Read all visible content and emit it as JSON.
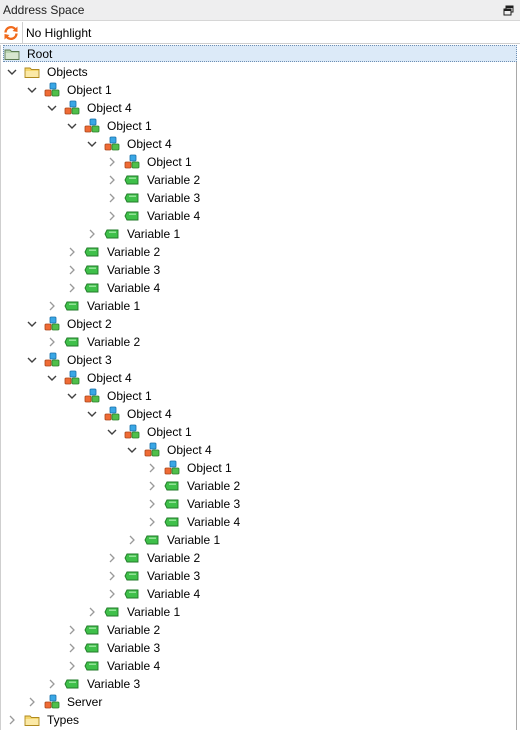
{
  "window": {
    "title": "Address Space"
  },
  "toolbar": {
    "highlight_label": "No Highlight"
  },
  "colors": {
    "selection": "#dceaf8",
    "variable_green": "#3fc04a",
    "folder_yellow": "#f5d76e"
  },
  "tree": [
    {
      "label": "Root",
      "depth": 0,
      "type": "root",
      "expand": "none",
      "selected": true
    },
    {
      "label": "Objects",
      "depth": 0,
      "type": "folder",
      "expand": "open"
    },
    {
      "label": "Object 1",
      "depth": 1,
      "type": "object",
      "expand": "open"
    },
    {
      "label": "Object 4",
      "depth": 2,
      "type": "object",
      "expand": "open"
    },
    {
      "label": "Object 1",
      "depth": 3,
      "type": "object",
      "expand": "open"
    },
    {
      "label": "Object 4",
      "depth": 4,
      "type": "object",
      "expand": "open"
    },
    {
      "label": "Object 1",
      "depth": 5,
      "type": "object",
      "expand": "closed"
    },
    {
      "label": "Variable 2",
      "depth": 5,
      "type": "variable",
      "expand": "closed"
    },
    {
      "label": "Variable 3",
      "depth": 5,
      "type": "variable",
      "expand": "closed"
    },
    {
      "label": "Variable 4",
      "depth": 5,
      "type": "variable",
      "expand": "closed"
    },
    {
      "label": "Variable 1",
      "depth": 4,
      "type": "variable",
      "expand": "closed"
    },
    {
      "label": "Variable 2",
      "depth": 3,
      "type": "variable",
      "expand": "closed"
    },
    {
      "label": "Variable 3",
      "depth": 3,
      "type": "variable",
      "expand": "closed"
    },
    {
      "label": "Variable 4",
      "depth": 3,
      "type": "variable",
      "expand": "closed"
    },
    {
      "label": "Variable 1",
      "depth": 2,
      "type": "variable",
      "expand": "closed"
    },
    {
      "label": "Object 2",
      "depth": 1,
      "type": "object",
      "expand": "open"
    },
    {
      "label": "Variable 2",
      "depth": 2,
      "type": "variable",
      "expand": "closed"
    },
    {
      "label": "Object 3",
      "depth": 1,
      "type": "object",
      "expand": "open"
    },
    {
      "label": "Object 4",
      "depth": 2,
      "type": "object",
      "expand": "open"
    },
    {
      "label": "Object 1",
      "depth": 3,
      "type": "object",
      "expand": "open"
    },
    {
      "label": "Object 4",
      "depth": 4,
      "type": "object",
      "expand": "open"
    },
    {
      "label": "Object 1",
      "depth": 5,
      "type": "object",
      "expand": "open"
    },
    {
      "label": "Object 4",
      "depth": 6,
      "type": "object",
      "expand": "open"
    },
    {
      "label": "Object 1",
      "depth": 7,
      "type": "object",
      "expand": "closed"
    },
    {
      "label": "Variable 2",
      "depth": 7,
      "type": "variable",
      "expand": "closed"
    },
    {
      "label": "Variable 3",
      "depth": 7,
      "type": "variable",
      "expand": "closed"
    },
    {
      "label": "Variable 4",
      "depth": 7,
      "type": "variable",
      "expand": "closed"
    },
    {
      "label": "Variable 1",
      "depth": 6,
      "type": "variable",
      "expand": "closed"
    },
    {
      "label": "Variable 2",
      "depth": 5,
      "type": "variable",
      "expand": "closed"
    },
    {
      "label": "Variable 3",
      "depth": 5,
      "type": "variable",
      "expand": "closed"
    },
    {
      "label": "Variable 4",
      "depth": 5,
      "type": "variable",
      "expand": "closed"
    },
    {
      "label": "Variable 1",
      "depth": 4,
      "type": "variable",
      "expand": "closed"
    },
    {
      "label": "Variable 2",
      "depth": 3,
      "type": "variable",
      "expand": "closed"
    },
    {
      "label": "Variable 3",
      "depth": 3,
      "type": "variable",
      "expand": "closed"
    },
    {
      "label": "Variable 4",
      "depth": 3,
      "type": "variable",
      "expand": "closed"
    },
    {
      "label": "Variable 3",
      "depth": 2,
      "type": "variable",
      "expand": "closed"
    },
    {
      "label": "Server",
      "depth": 1,
      "type": "object",
      "expand": "closed"
    },
    {
      "label": "Types",
      "depth": 0,
      "type": "folder",
      "expand": "closed"
    }
  ]
}
